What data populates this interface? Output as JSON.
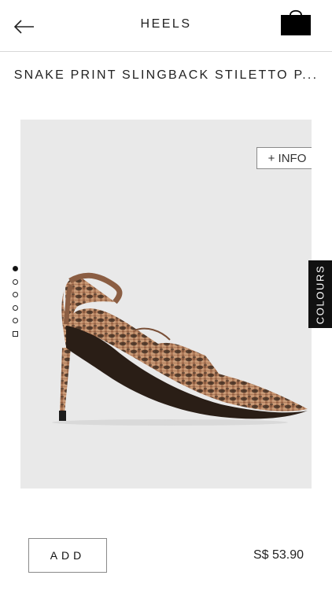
{
  "header": {
    "title": "HEELS",
    "back_icon": "arrow-left-icon",
    "bag_icon": "shopping-bag-icon"
  },
  "product": {
    "name": "SNAKE PRINT SLINGBACK STILETTO P...",
    "price": "S$ 53.90",
    "image": "snake-print-slingback-heel"
  },
  "gallery": {
    "info_label": "+ INFO",
    "colours_label": "COLOURS",
    "slides": 6,
    "active_slide": 1
  },
  "actions": {
    "add_label": "ADD"
  },
  "colors": {
    "accent": "#111111",
    "panel_bg": "#e9e9e9",
    "snake_base": "#b07b5a",
    "snake_dark": "#3a2a20"
  }
}
